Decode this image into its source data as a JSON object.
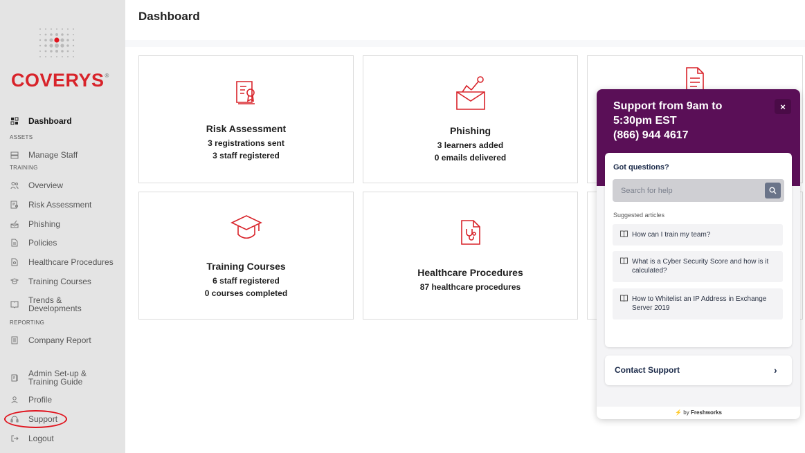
{
  "page": {
    "title": "Dashboard"
  },
  "brand": {
    "name": "COVERYS",
    "mark": "®",
    "accent": "#d8232a"
  },
  "sidebar": {
    "dashboard": "Dashboard",
    "section_assets": "ASSETS",
    "manage_staff": "Manage Staff",
    "section_training": "TRAINING",
    "overview": "Overview",
    "risk_assessment": "Risk Assessment",
    "phishing": "Phishing",
    "policies": "Policies",
    "healthcare_procedures": "Healthcare Procedures",
    "training_courses": "Training Courses",
    "trends_line1": "Trends &",
    "trends_line2": "Developments",
    "section_reporting": "REPORTING",
    "company_report": "Company Report",
    "admin_line1": "Admin Set-up &",
    "admin_line2": "Training Guide",
    "profile": "Profile",
    "support": "Support",
    "logout": "Logout"
  },
  "cards": {
    "risk": {
      "title": "Risk Assessment",
      "line1": "3 registrations sent",
      "line2": "3 staff registered"
    },
    "phishing": {
      "title": "Phishing",
      "line1": "3 learners added",
      "line2": "0 emails delivered"
    },
    "training": {
      "title": "Training Courses",
      "line1": "6 staff registered",
      "line2": "0 courses completed"
    },
    "healthcare": {
      "title": "Healthcare Procedures",
      "line1": "87 healthcare procedures"
    }
  },
  "widget": {
    "title_line1": "Support from 9am to",
    "title_line2": "5:30pm EST",
    "title_line3": "(866) 944 4617",
    "close": "×",
    "questions": "Got questions?",
    "search_placeholder": "Search for help",
    "suggested": "Suggested articles",
    "articles": [
      "How can I train my team?",
      "What is a Cyber Security Score and how is it calculated?",
      "How to Whitelist an IP Address in Exchange Server 2019"
    ],
    "contact": "Contact Support",
    "contact_arrow": "›",
    "footer_by": "by",
    "footer_brand": "Freshworks",
    "header_color": "#5a0f57"
  }
}
